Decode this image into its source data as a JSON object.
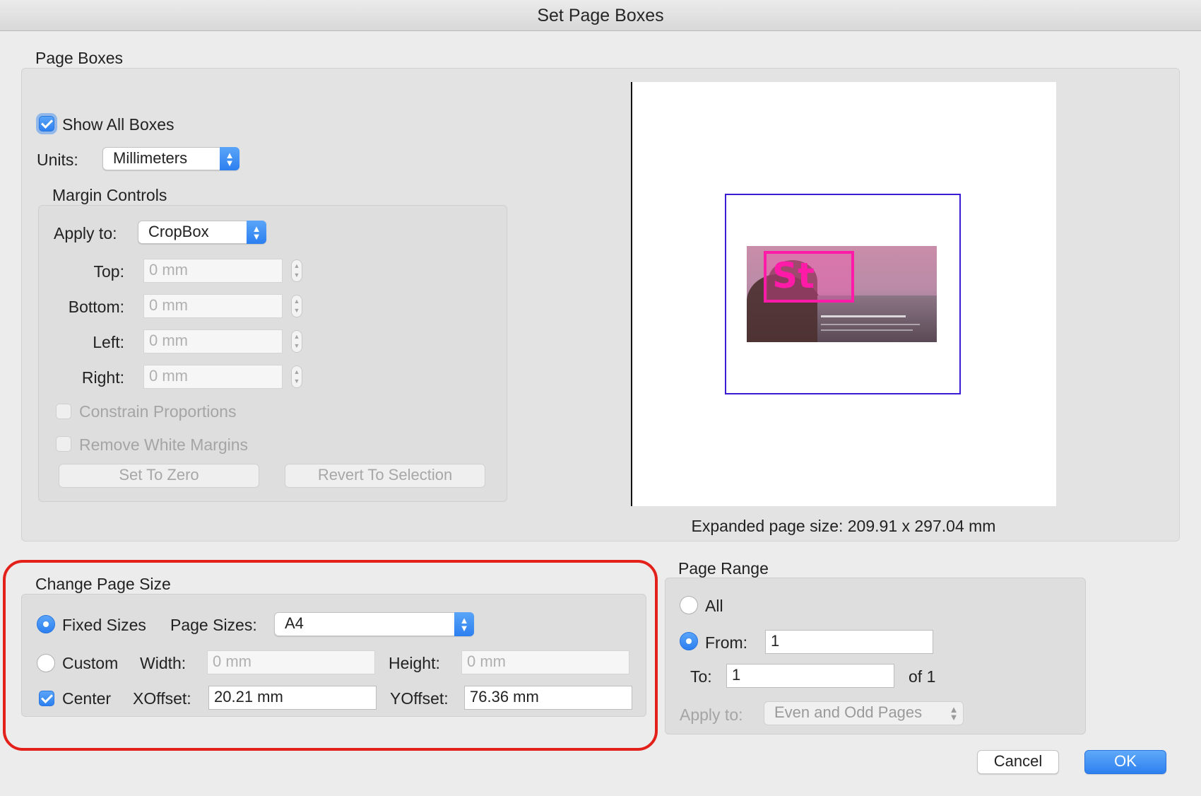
{
  "window": {
    "title": "Set Page Boxes"
  },
  "page_boxes": {
    "label": "Page Boxes",
    "show_all_boxes": {
      "label": "Show All Boxes",
      "checked": true
    },
    "units": {
      "label": "Units:",
      "value": "Millimeters"
    },
    "margin_controls": {
      "label": "Margin Controls",
      "apply_to": {
        "label": "Apply to:",
        "value": "CropBox"
      },
      "top": {
        "label": "Top:",
        "value": "0 mm"
      },
      "bottom": {
        "label": "Bottom:",
        "value": "0 mm"
      },
      "left": {
        "label": "Left:",
        "value": "0 mm"
      },
      "right": {
        "label": "Right:",
        "value": "0 mm"
      },
      "constrain_proportions": {
        "label": "Constrain Proportions",
        "checked": false
      },
      "remove_white_margins": {
        "label": "Remove White Margins",
        "checked": false
      },
      "set_to_zero": "Set To Zero",
      "revert_to_selection": "Revert To Selection"
    },
    "preview": {
      "thumb_text": "St",
      "expanded_size": "Expanded page size: 209.91 x 297.04 mm"
    }
  },
  "change_page_size": {
    "label": "Change Page Size",
    "fixed_sizes": {
      "label": "Fixed Sizes",
      "selected": true
    },
    "page_sizes": {
      "label": "Page Sizes:",
      "value": "A4"
    },
    "custom": {
      "label": "Custom",
      "selected": false
    },
    "width": {
      "label": "Width:",
      "value": "0 mm"
    },
    "height": {
      "label": "Height:",
      "value": "0 mm"
    },
    "center": {
      "label": "Center",
      "checked": true
    },
    "xoffset": {
      "label": "XOffset:",
      "value": "20.21 mm"
    },
    "yoffset": {
      "label": "YOffset:",
      "value": "76.36 mm"
    }
  },
  "page_range": {
    "label": "Page Range",
    "all": {
      "label": "All",
      "selected": false
    },
    "from": {
      "label": "From:",
      "value": "1",
      "selected": true
    },
    "to": {
      "label": "To:",
      "value": "1"
    },
    "of": "of 1",
    "apply_to": {
      "label": "Apply to:",
      "value": "Even and Odd Pages"
    }
  },
  "buttons": {
    "cancel": "Cancel",
    "ok": "OK"
  },
  "colors": {
    "accent": "#2c7ff0",
    "highlight": "#e32019",
    "cropbox": "#ff1ba7",
    "mediabox": "#3a1bd6"
  }
}
